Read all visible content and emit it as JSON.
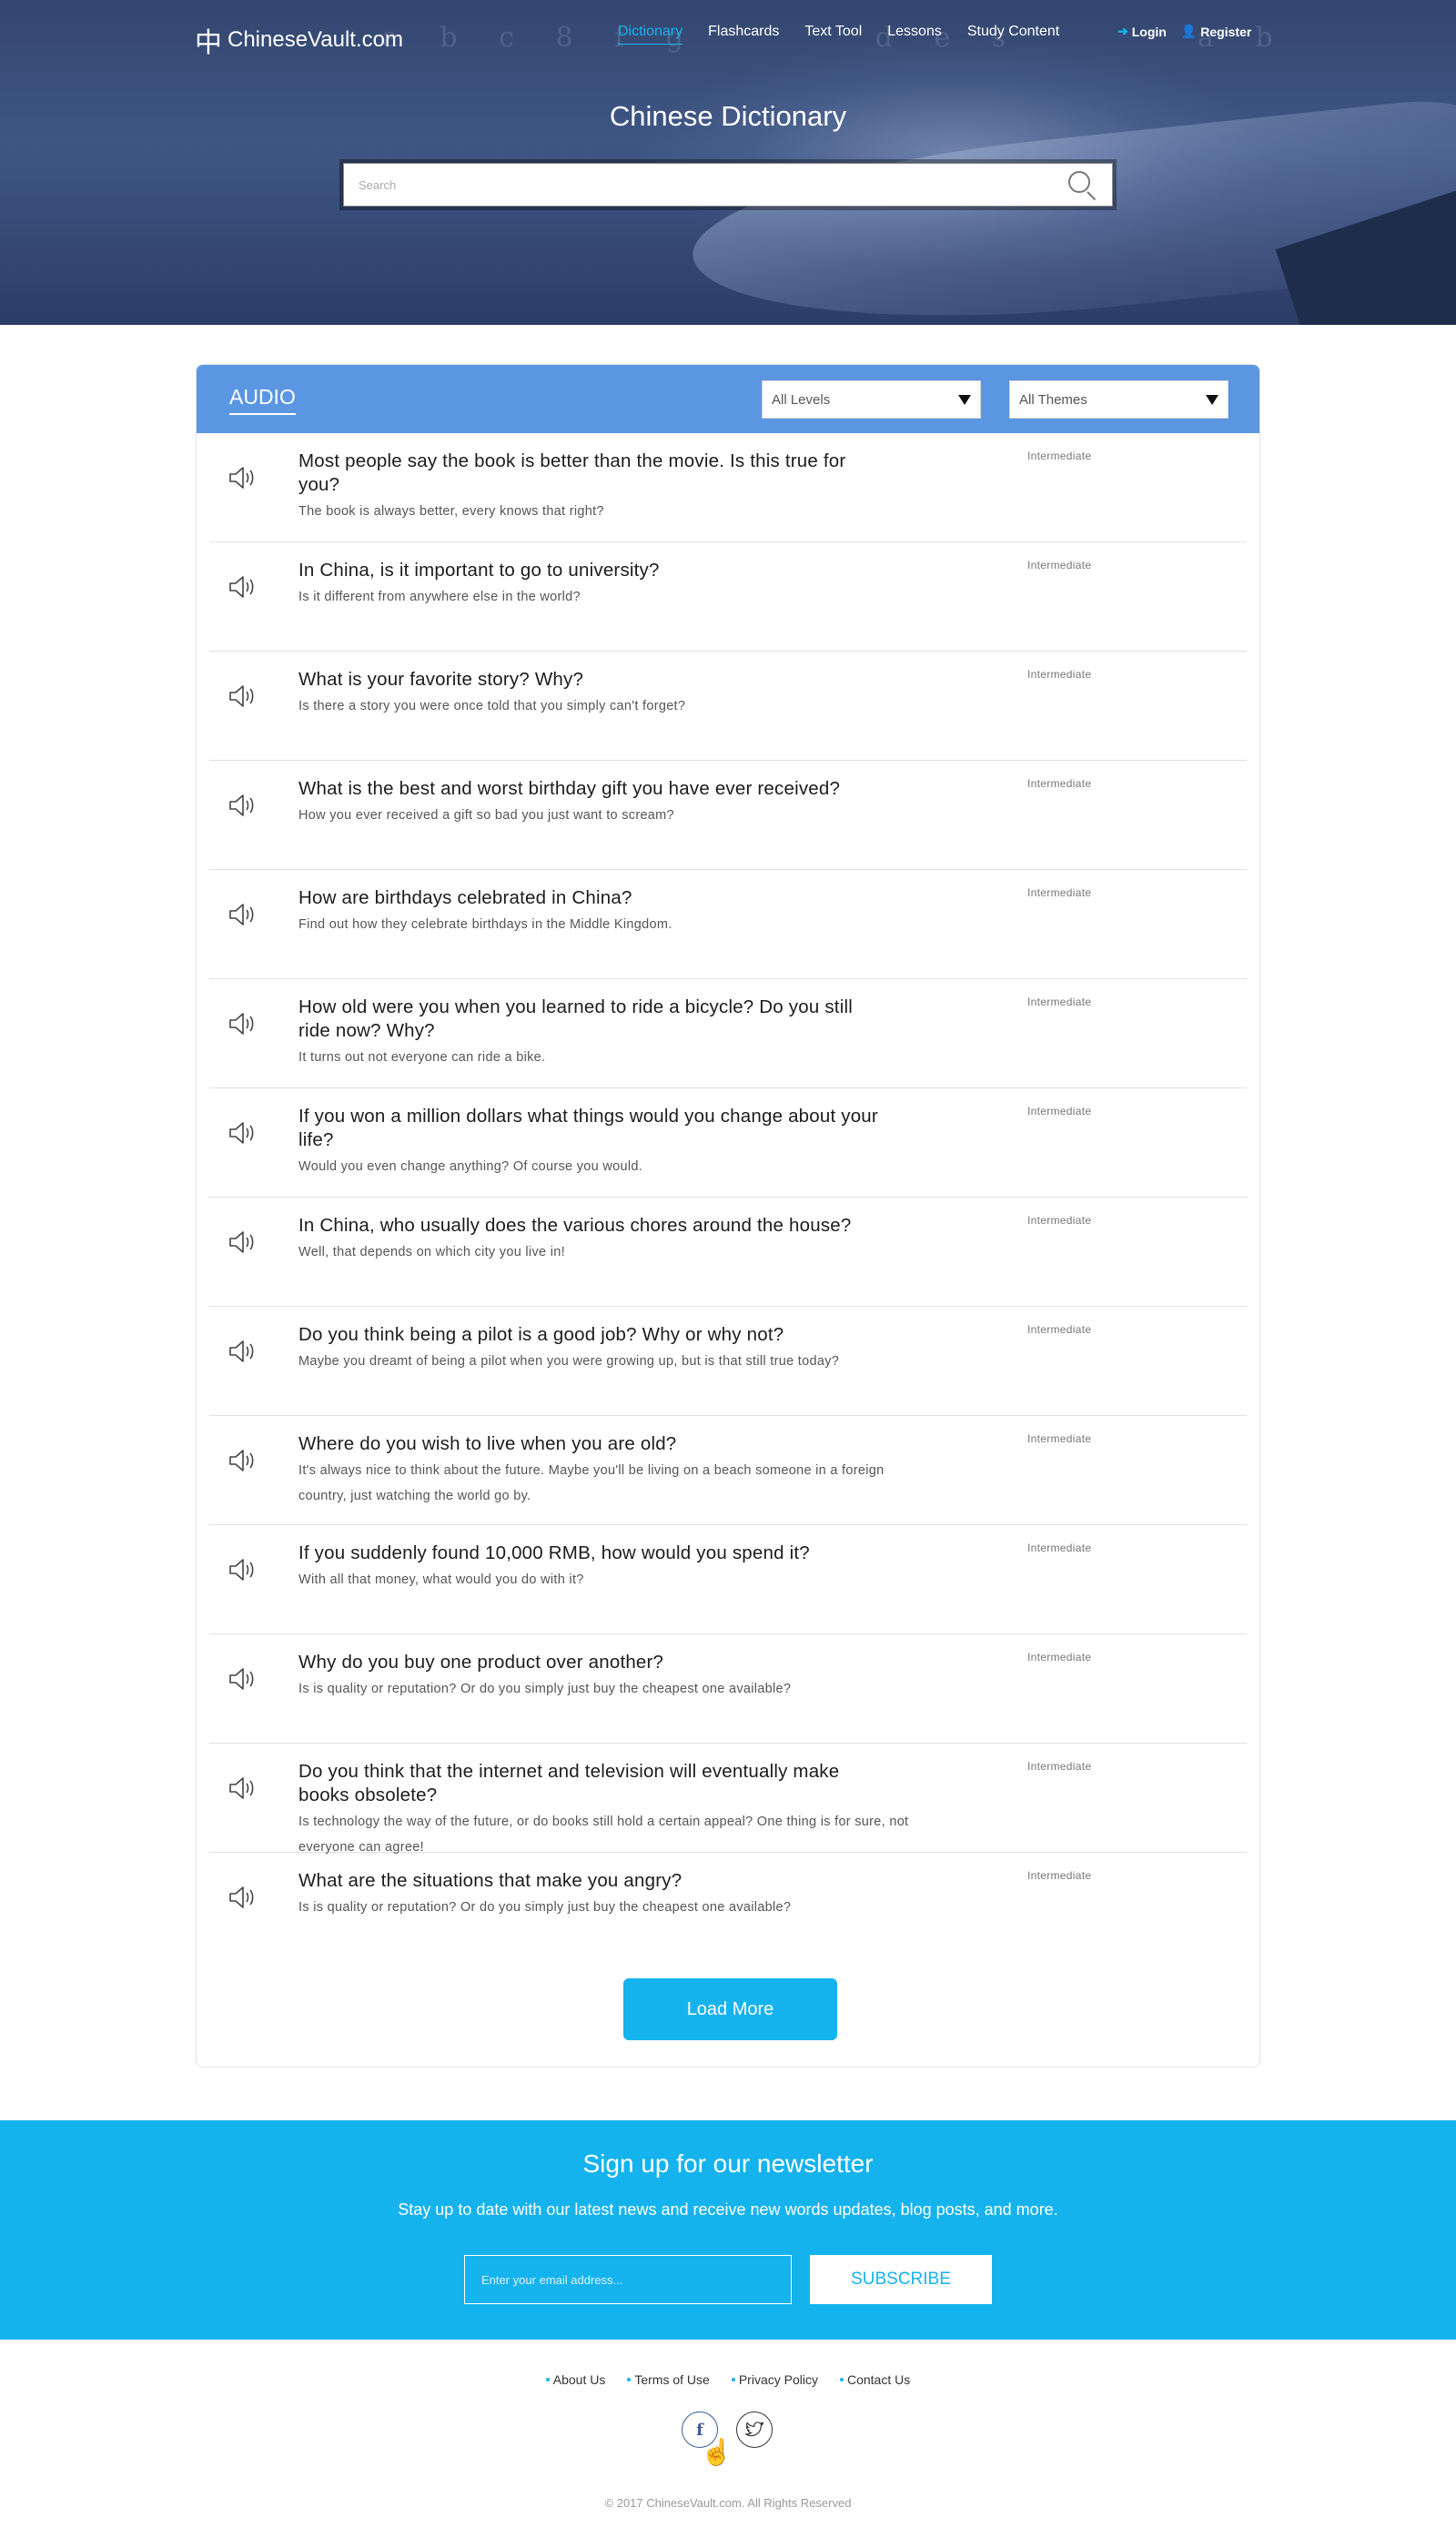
{
  "nav": {
    "logo_mark": "中",
    "logo_text": "ChineseVault.com",
    "links": [
      "Dictionary",
      "Flashcards",
      "Text Tool",
      "Lessons",
      "Study Content"
    ],
    "active": "Dictionary",
    "login": "Login",
    "register": "Register"
  },
  "hero": {
    "title": "Chinese Dictionary",
    "search_placeholder": "Search"
  },
  "audio": {
    "title": "AUDIO",
    "level_filter": "All Levels",
    "theme_filter": "All Themes",
    "items": [
      {
        "title": "Most people say the book is better than the movie. Is this true for you?",
        "subtitle": "The book is always better, every knows that right?",
        "level": "Intermediate"
      },
      {
        "title": "In China, is it important to go to university?",
        "subtitle": "Is it different from anywhere else in the world?",
        "level": "Intermediate"
      },
      {
        "title": "What is your favorite story? Why?",
        "subtitle": "Is there a story you were once told that you simply can't forget?",
        "level": "Intermediate"
      },
      {
        "title": "What is the best and worst birthday gift you have ever received?",
        "subtitle": "How you ever received a gift so bad you just want to scream?",
        "level": "Intermediate"
      },
      {
        "title": "How are birthdays celebrated in China?",
        "subtitle": "Find out how they celebrate birthdays in the Middle Kingdom.",
        "level": "Intermediate"
      },
      {
        "title": "How old were you when you learned to ride a bicycle? Do you still ride now? Why?",
        "subtitle": "It turns out not everyone can ride a bike.",
        "level": "Intermediate"
      },
      {
        "title": "If you won a million dollars what things would you change about your life?",
        "subtitle": "Would you even change anything? Of course you would.",
        "level": "Intermediate"
      },
      {
        "title": "In China, who usually does the various chores around the house?",
        "subtitle": "Well, that depends on which city you live in!",
        "level": "Intermediate"
      },
      {
        "title": "Do you think being a pilot is a good job? Why or why not?",
        "subtitle": "Maybe you dreamt of being a pilot when you were growing up, but is that still true today?",
        "level": "Intermediate"
      },
      {
        "title": "Where do you wish to live when you are old?",
        "subtitle": "It's always nice to think about the future. Maybe you'll be living on a beach someone in a foreign country, just watching the world go by.",
        "level": "Intermediate"
      },
      {
        "title": "If you suddenly found 10,000 RMB, how would you spend it?",
        "subtitle": "With all that money, what would you do with it?",
        "level": "Intermediate"
      },
      {
        "title": "Why do you buy one product over another?",
        "subtitle": "Is is quality or reputation? Or do you simply just buy the cheapest one available?",
        "level": "Intermediate"
      },
      {
        "title": "Do you think that the internet and television will eventually make books obsolete?",
        "subtitle": "Is technology the way of the future, or do books still hold a certain appeal? One thing is for sure, not everyone can agree!",
        "level": "Intermediate"
      },
      {
        "title": "What are the situations that make you angry?",
        "subtitle": "Is is quality or reputation? Or do you simply just buy the cheapest one available?",
        "level": "Intermediate"
      }
    ],
    "load_more": "Load More"
  },
  "newsletter": {
    "title": "Sign up for our newsletter",
    "subtitle": "Stay up to date with our latest news and receive new words updates, blog posts, and more.",
    "email_placeholder": "Enter your email address...",
    "button": "SUBSCRIBE"
  },
  "footer": {
    "links": [
      "About Us",
      "Terms of Use",
      "Privacy Policy",
      "Contact Us"
    ],
    "social": [
      "facebook-icon",
      "twitter-icon"
    ],
    "copyright": "© 2017 ChineseVault.com. All Rights Reserved"
  },
  "colors": {
    "accent": "#15b3ee",
    "card_header": "#5b96e2",
    "hero_bg": "#3f5685"
  }
}
